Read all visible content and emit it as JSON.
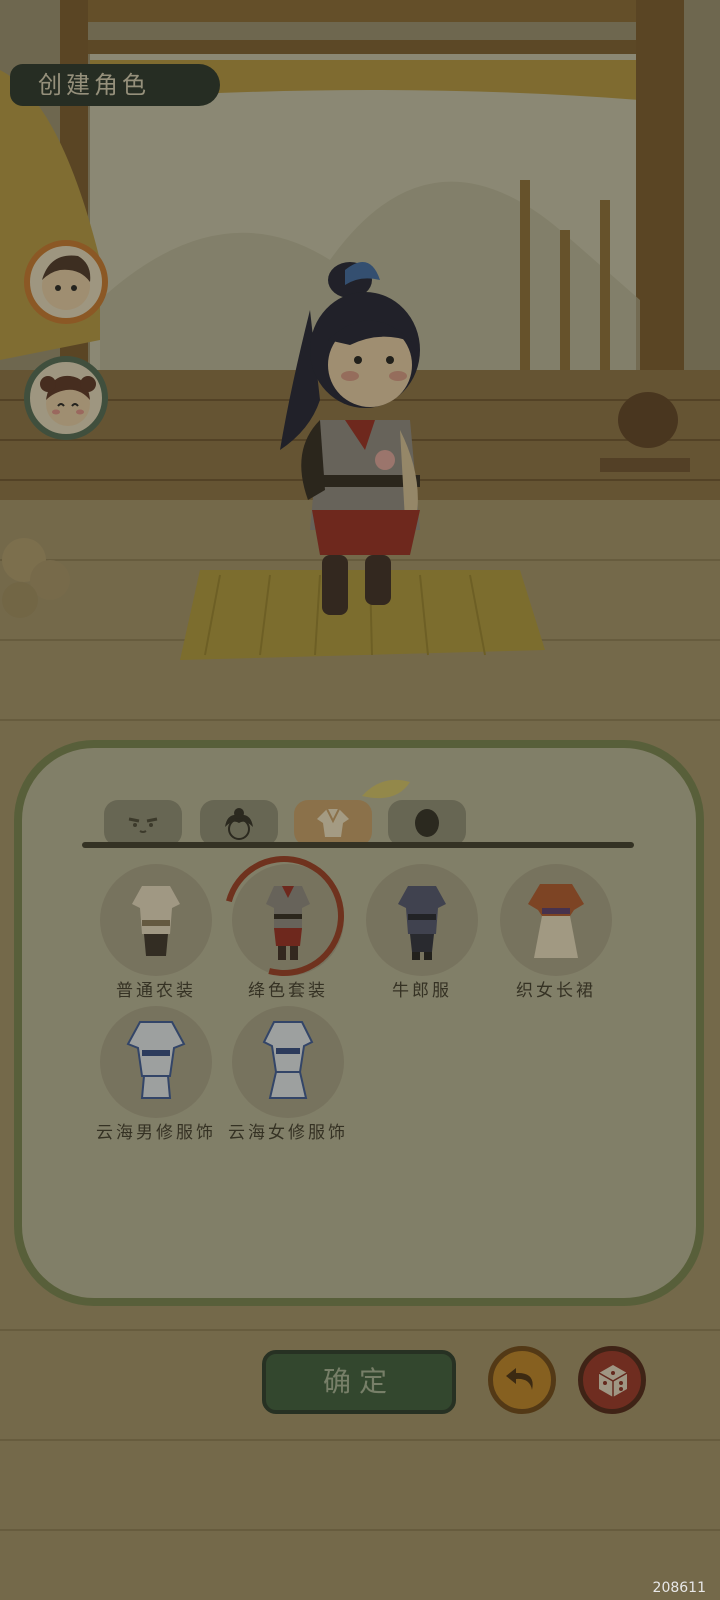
{
  "header": {
    "title": "创建角色"
  },
  "gender": [
    "male-portrait",
    "female-portrait"
  ],
  "tabs": [
    {
      "icon": "face-icon",
      "active": false
    },
    {
      "icon": "hairstyle-icon",
      "active": false
    },
    {
      "icon": "clothing-icon",
      "active": true
    },
    {
      "icon": "skin-color-icon",
      "active": false
    }
  ],
  "outfits": [
    {
      "name": "普通农装",
      "selected": false
    },
    {
      "name": "绛色套装",
      "selected": true
    },
    {
      "name": "牛郎服",
      "selected": false
    },
    {
      "name": "织女长裙",
      "selected": false
    },
    {
      "name": "云海男修服饰",
      "selected": false
    },
    {
      "name": "云海女修服饰",
      "selected": false
    }
  ],
  "actions": {
    "confirm_label": "确定",
    "undo_icon": "undo-icon",
    "random_icon": "dice-icon"
  },
  "footer": {
    "build_id": "208611"
  }
}
